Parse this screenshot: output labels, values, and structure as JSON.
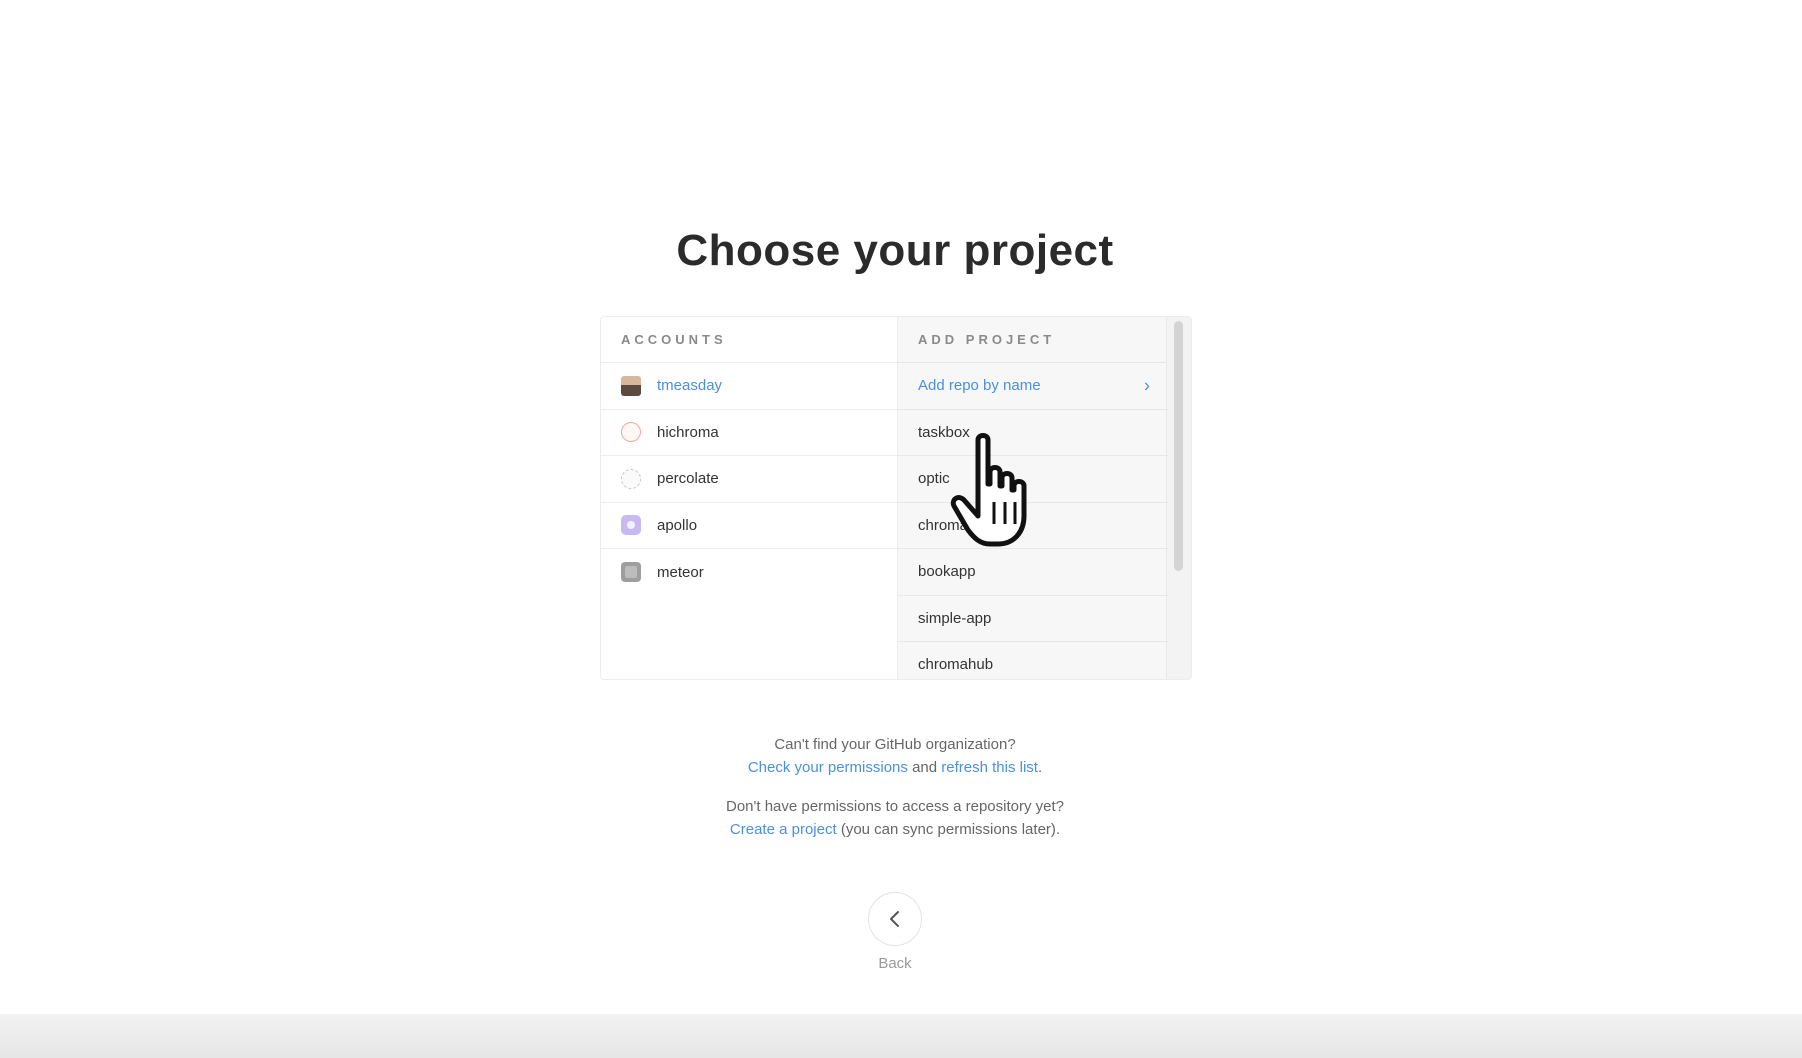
{
  "title": "Choose your project",
  "accounts": {
    "header": "ACCOUNTS",
    "items": [
      {
        "label": "tmeasday",
        "icon": "user-avatar-icon",
        "active": true
      },
      {
        "label": "hichroma",
        "icon": "chroma-logo-icon",
        "active": false
      },
      {
        "label": "percolate",
        "icon": "percolate-logo-icon",
        "active": false
      },
      {
        "label": "apollo",
        "icon": "apollo-logo-icon",
        "active": false
      },
      {
        "label": "meteor",
        "icon": "meteor-logo-icon",
        "active": false
      }
    ]
  },
  "projects": {
    "header": "ADD PROJECT",
    "add_repo_label": "Add repo by name",
    "items": [
      "taskbox",
      "optic",
      "chroma",
      "bookapp",
      "simple-app",
      "chromahub"
    ]
  },
  "help": {
    "line1": "Can't find your GitHub organization?",
    "check_permissions": "Check your permissions",
    "and": " and ",
    "refresh_list": "refresh this list",
    "period": ".",
    "line3": "Don't have permissions to access a repository yet?",
    "create_project": "Create a project",
    "sync_later": " (you can sync permissions later)."
  },
  "back": {
    "label": "Back"
  },
  "colors": {
    "accent": "#4a90e2",
    "text": "#333333",
    "muted": "#8a8a8a"
  }
}
